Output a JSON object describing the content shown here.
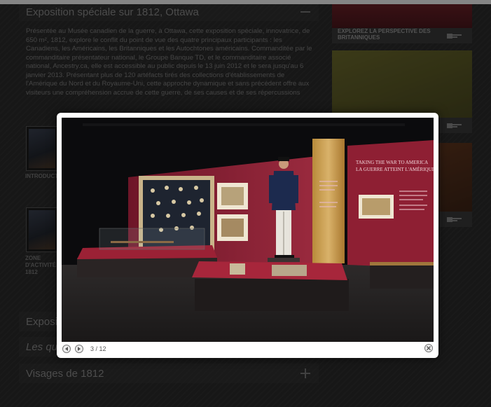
{
  "sections": {
    "special": {
      "title": "Exposition spéciale sur 1812, Ottawa",
      "description": "Présentée au Musée canadien de la guerre, à Ottawa, cette exposition spéciale, innovatrice, de 650 m², 1812, explore le conflit du point de vue des quatre principaux participants : les Canadiens, les Américains, les Britanniques et les Autochtones américains. Commanditée par le commanditaire présentateur national, le Groupe Banque TD, et le commanditaire associé national, Ancestry.ca, elle est accessible au public depuis le 13 juin 2012 et le sera jusqu'au 6 janvier 2013. Présentant plus de 120 artéfacts tirés des collections d'établissements de l'Amérique du Nord et du Royaume-Uni, cette approche dynamique et sans précédent offre aux visiteurs une compréhension accrue de cette guerre, de ses causes et de ses répercussions"
    },
    "thumbs": [
      {
        "label": "INTRODUCTION"
      },
      {
        "label": "ZONE D'ACTIVITÉ 1812"
      }
    ],
    "collapsed": [
      {
        "title": "Expositio"
      },
      {
        "title": "Les qu"
      },
      {
        "title": "Visages de 1812"
      }
    ]
  },
  "cards": [
    {
      "caption": "EXPLOREZ LA PERSPECTIVE DES BRITANNIQUES"
    },
    {
      "caption": ""
    },
    {
      "caption": ""
    }
  ],
  "lightbox": {
    "counter": "3 / 12",
    "photo": {
      "banner_en": "TAKING THE WAR TO AMERICA",
      "banner_fr": "LA GUERRE ATTEINT L'AMÉRIQUE"
    }
  },
  "colors": {
    "exhibit_wall": "#8e1f33",
    "card1": "#5a1e24",
    "card2": "#5b5a24",
    "card3": "#5b3522"
  }
}
